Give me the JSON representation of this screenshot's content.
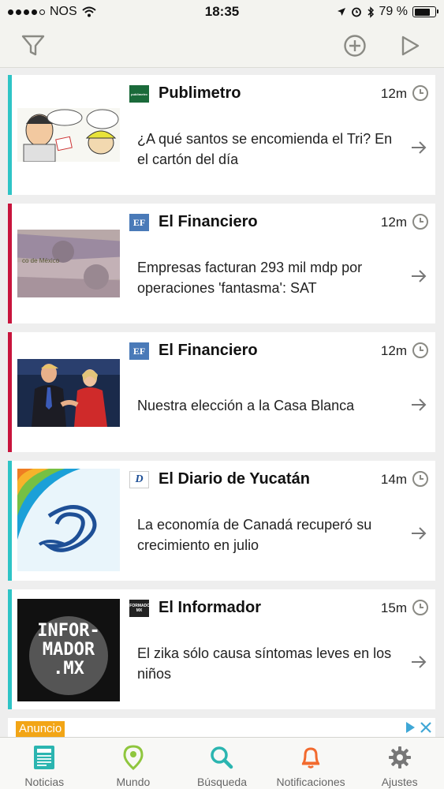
{
  "status_bar": {
    "carrier": "NOS",
    "time": "18:35",
    "battery": "79 %",
    "battery_level": 0.79
  },
  "toolbar": {
    "filter_icon": "filter-icon",
    "add_icon": "plus-circle-icon",
    "play_icon": "play-icon"
  },
  "feed": {
    "items": [
      {
        "source": "Publimetro",
        "time": "12m",
        "headline": "¿A qué santos se encomienda el Tri? En el cartón del día",
        "accent_color": "#2ec4c6",
        "logo_text": "publimetro"
      },
      {
        "source": "El Financiero",
        "time": "12m",
        "headline": "Empresas facturan 293 mil mdp por operaciones 'fantasma': SAT",
        "accent_color": "#c8143c",
        "logo_text": "EF"
      },
      {
        "source": "El Financiero",
        "time": "12m",
        "headline": "Nuestra elección a la Casa Blanca",
        "accent_color": "#c8143c",
        "logo_text": "EF"
      },
      {
        "source": "El Diario de Yucatán",
        "time": "14m",
        "headline": "La economía de Canadá recuperó su crecimiento en julio",
        "accent_color": "#2ec4c6",
        "logo_text": "D"
      },
      {
        "source": "El Informador",
        "time": "15m",
        "headline": "El zika sólo causa síntomas leves en los niños",
        "accent_color": "#2ec4c6",
        "logo_text": "INFORMADOR MX",
        "thumb_text": [
          "INFOR-",
          "MADOR",
          ".MX"
        ]
      }
    ]
  },
  "ad": {
    "label": "Anuncio"
  },
  "tabbar": {
    "tabs": [
      {
        "label": "Noticias",
        "color": "#2bb5b0",
        "icon": "newspaper-icon"
      },
      {
        "label": "Mundo",
        "color": "#8fc63e",
        "icon": "map-pin-icon"
      },
      {
        "label": "Búsqueda",
        "color": "#2bb5b0",
        "icon": "search-icon"
      },
      {
        "label": "Notificaciones",
        "color": "#f26a2e",
        "icon": "bell-icon"
      },
      {
        "label": "Ajustes",
        "color": "#777777",
        "icon": "gear-icon"
      }
    ]
  }
}
